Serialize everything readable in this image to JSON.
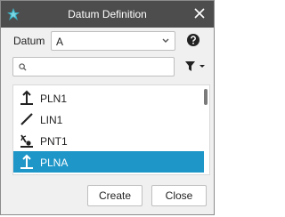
{
  "window": {
    "title": "Datum Definition"
  },
  "datum": {
    "label": "Datum",
    "selected": "A"
  },
  "search": {
    "placeholder": "",
    "value": ""
  },
  "list": {
    "items": [
      {
        "label": "PLN1",
        "icon": "plane-datum-icon"
      },
      {
        "label": "LIN1",
        "icon": "line-datum-icon"
      },
      {
        "label": "PNT1",
        "icon": "point-datum-icon"
      },
      {
        "label": "PLNA",
        "icon": "plane-datum-icon",
        "selected": true
      }
    ]
  },
  "buttons": {
    "create": "Create",
    "close": "Close"
  },
  "colors": {
    "titlebar": "#4d4d4d",
    "selection": "#1e96c8",
    "logo": "#3cb4c8"
  }
}
